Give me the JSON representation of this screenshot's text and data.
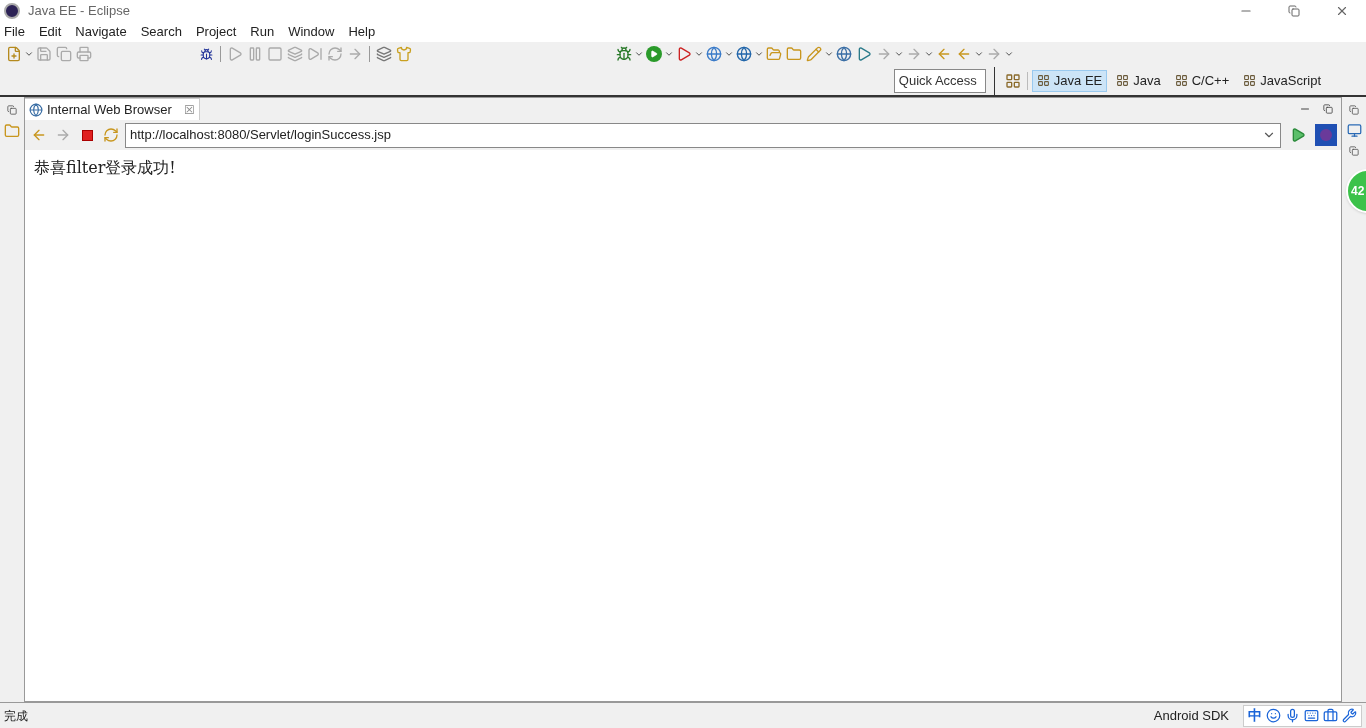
{
  "window": {
    "title": "Java EE - Eclipse"
  },
  "menu": [
    "File",
    "Edit",
    "Navigate",
    "Search",
    "Project",
    "Run",
    "Window",
    "Help"
  ],
  "quick_access": {
    "placeholder": "Quick Access"
  },
  "perspectives": [
    {
      "label": "Java EE",
      "selected": true
    },
    {
      "label": "Java",
      "selected": false
    },
    {
      "label": "C/C++",
      "selected": false
    },
    {
      "label": "JavaScript",
      "selected": false
    }
  ],
  "editor_tab": {
    "title": "Internal Web Browser",
    "close": "☒"
  },
  "browser": {
    "url": "http://localhost:8080/Servlet/loginSuccess.jsp",
    "page_text": "恭喜filter登录成功!"
  },
  "floating_badge": "42",
  "status_bar": {
    "left": "完成",
    "right": "Android SDK",
    "ime_mode": "中"
  }
}
